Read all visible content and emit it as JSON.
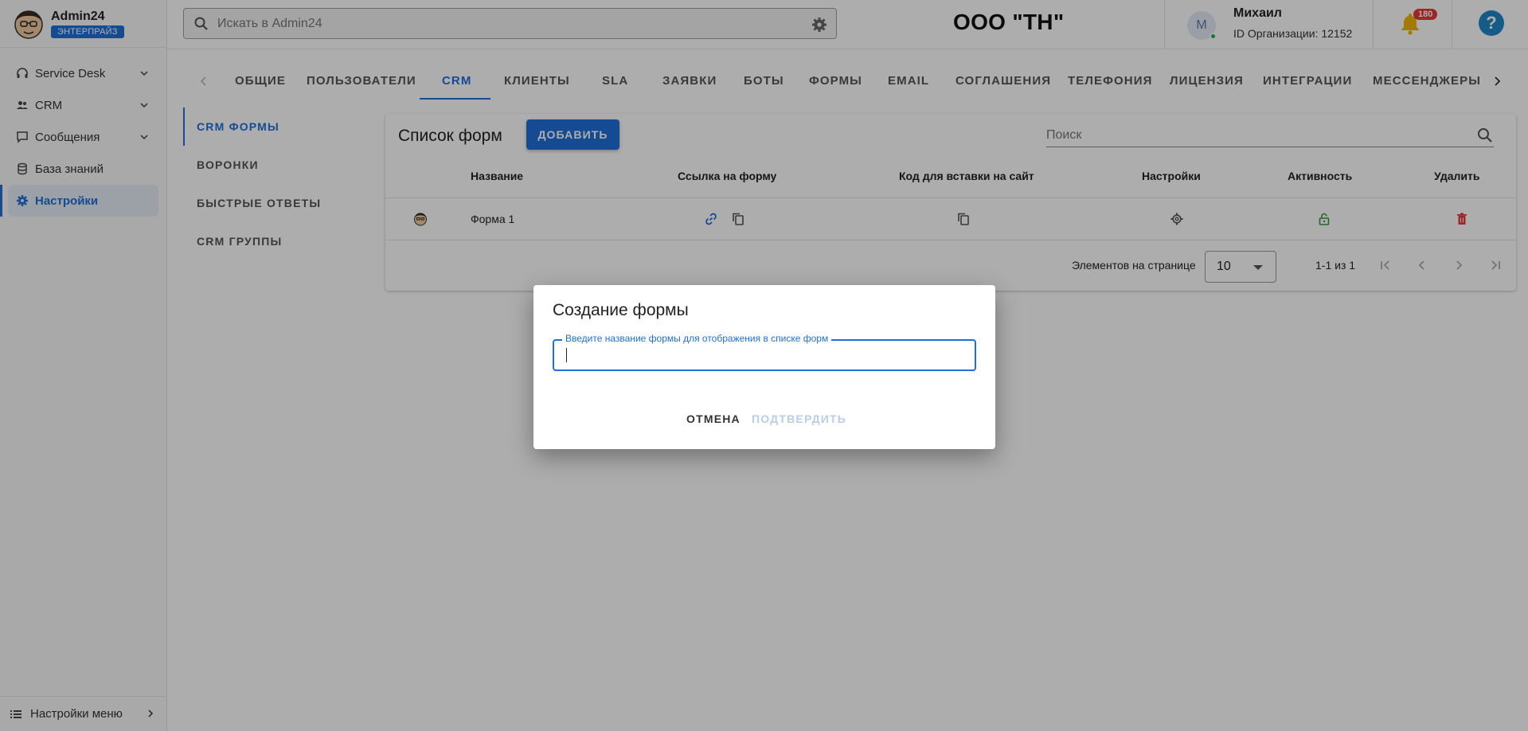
{
  "brand": {
    "name": "Admin24",
    "plan": "ЭНТЕРПРАЙЗ"
  },
  "sidebar": {
    "items": [
      {
        "label": "Service Desk",
        "icon": "headset-icon"
      },
      {
        "label": "CRM",
        "icon": "people-icon"
      },
      {
        "label": "Сообщения",
        "icon": "chat-icon"
      },
      {
        "label": "База знаний",
        "icon": "database-icon"
      },
      {
        "label": "Настройки",
        "icon": "gear-icon"
      }
    ],
    "bottom_label": "Настройки меню"
  },
  "header": {
    "search_placeholder": "Искать в Admin24",
    "org_title": "ООО \"ТН\"",
    "user_initial": "М",
    "user_name": "Михаил",
    "org_id": "ID Организации: 12152",
    "notifications": "180",
    "help": "?"
  },
  "tabs": [
    "ОБЩИЕ",
    "ПОЛЬЗОВАТЕЛИ",
    "CRM",
    "КЛИЕНТЫ",
    "SLA",
    "ЗАЯВКИ",
    "БОТЫ",
    "ФОРМЫ",
    "EMAIL",
    "СОГЛАШЕНИЯ",
    "ТЕЛЕФОНИЯ",
    "ЛИЦЕНЗИЯ",
    "ИНТЕГРАЦИИ",
    "МЕССЕНДЖЕРЫ"
  ],
  "active_tab": "CRM",
  "subnav": [
    "CRM ФОРМЫ",
    "ВОРОНКИ",
    "БЫСТРЫЕ ОТВЕТЫ",
    "CRM ГРУППЫ"
  ],
  "list": {
    "title": "Список форм",
    "add_label": "ДОБАВИТЬ",
    "search_placeholder": "Поиск",
    "columns": [
      "Название",
      "Ссылка на форму",
      "Код для вставки на сайт",
      "Настройки",
      "Активность",
      "Удалить"
    ],
    "rows": [
      {
        "name": "Форма 1"
      }
    ],
    "per_page_label": "Элементов на странице",
    "per_page": "10",
    "range": "1-1 из 1"
  },
  "dialog": {
    "title": "Создание формы",
    "field_label": "Введите название формы для отображения в списке форм",
    "field_value": "",
    "cancel": "ОТМЕНА",
    "confirm": "ПОДТВЕРДИТЬ"
  },
  "colors": {
    "accent": "#1e6fd9",
    "danger": "#e53935",
    "success": "#2e9b3f"
  }
}
